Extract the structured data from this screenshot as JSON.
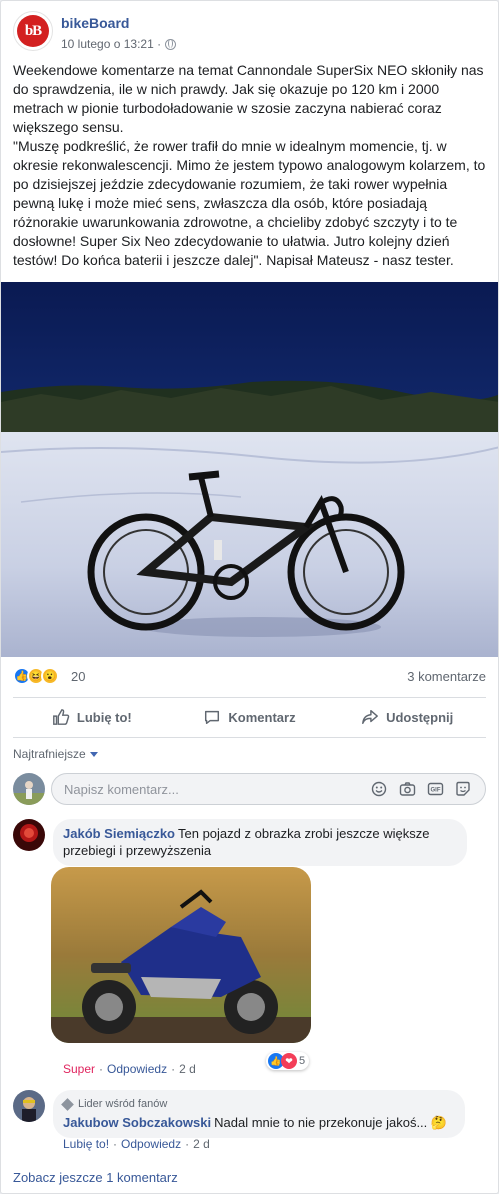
{
  "post": {
    "page_name": "bikeBoard",
    "logo_text": "bB",
    "timestamp": "10 lutego o 13:21 ·",
    "privacy_icon": "globe-icon",
    "text_paragraphs": [
      "Weekendowe komentarze na temat Cannondale SuperSix NEO skłoniły nas do sprawdzenia, ile w nich prawdy. Jak się okazuje po 120 km i 2000 metrach w pionie turbodoładowanie w szosie zaczyna nabierać coraz większego sensu.",
      "\"Muszę podkreślić, że rower trafił do mnie w idealnym momencie, tj. w okresie rekonwalescencji. Mimo że jestem typowo analogowym kolarzem, to po dzisiejszej jeździe zdecydowanie rozumiem, że taki rower wypełnia pewną lukę i może mieć sens, zwłaszcza dla osób, które posiadają różnorakie uwarunkowania zdrowotne, a chcieliby zdobyć szczyty i to te dosłowne! Super Six Neo zdecydowanie to ułatwia. Jutro kolejny dzień testów! Do końca baterii i jeszcze dalej\". Napisał Mateusz - nasz tester."
    ]
  },
  "stats": {
    "reaction_count": "20",
    "comments_count": "3 komentarze"
  },
  "actions": {
    "like": "Lubię to!",
    "comment": "Komentarz",
    "share": "Udostępnij"
  },
  "sort_label": "Najtrafniejsze",
  "composer": {
    "placeholder": "Napisz komentarz..."
  },
  "comments": [
    {
      "author": "Jakób Siemiączko",
      "text": "Ten pojazd z obrazka zrobi jeszcze większe przebiegi i przewyższenia",
      "reaction_label": "Super",
      "reply": "Odpowiedz",
      "age": "2 d",
      "reaction_count": "5"
    },
    {
      "badge": "Lider wśród fanów",
      "author": "Jakubow Sobczakowski",
      "text": "Nadal mnie to nie przekonuje jakoś...",
      "like": "Lubię to!",
      "reply": "Odpowiedz",
      "age": "2 d"
    }
  ],
  "more_comments": "Zobacz jeszcze 1 komentarz",
  "colors": {
    "link": "#385898",
    "brand_red": "#d32020",
    "like_blue": "#1877f2",
    "super_pink": "#e0245e"
  }
}
